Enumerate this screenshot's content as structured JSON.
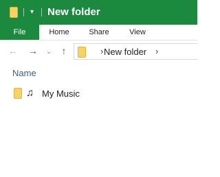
{
  "window": {
    "title": "New folder"
  },
  "quick_access": {
    "dropdown_glyph": "▾"
  },
  "ribbon": {
    "tabs": [
      {
        "label": "File"
      },
      {
        "label": "Home"
      },
      {
        "label": "Share"
      },
      {
        "label": "View"
      }
    ]
  },
  "navigation": {
    "back_glyph": "←",
    "forward_glyph": "→",
    "recent_glyph": "⌄",
    "up_glyph": "↑",
    "address": {
      "separator": "›",
      "path": "New folder",
      "trailing_separator": "›"
    }
  },
  "file_list": {
    "column_header": "Name",
    "items": [
      {
        "name": "My Music",
        "overlay_glyph": "♫"
      }
    ]
  },
  "colors": {
    "accent": "#1c8a3e",
    "folder": "#f6d365",
    "header_text": "#3b5f8a"
  }
}
